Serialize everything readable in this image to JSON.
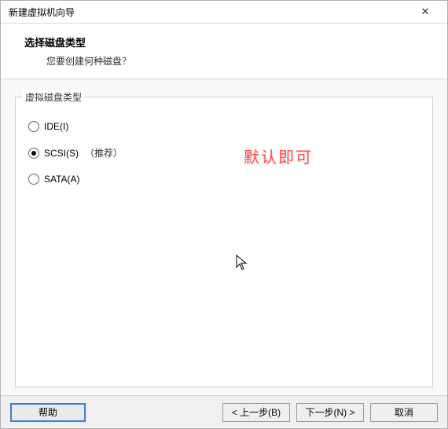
{
  "titlebar": {
    "title": "新建虚拟机向导",
    "close": "✕"
  },
  "header": {
    "title": "选择磁盘类型",
    "subtitle": "您要创建何种磁盘？"
  },
  "group": {
    "legend": "虚拟磁盘类型",
    "options": [
      {
        "label": "IDE(I)",
        "checked": false,
        "recommend": ""
      },
      {
        "label": "SCSI(S)",
        "checked": true,
        "recommend": "（推荐）"
      },
      {
        "label": "SATA(A)",
        "checked": false,
        "recommend": ""
      }
    ]
  },
  "annotation": "默认即可",
  "footer": {
    "help": "帮助",
    "back": "< 上一步(B)",
    "next": "下一步(N) >",
    "cancel": "取消"
  }
}
